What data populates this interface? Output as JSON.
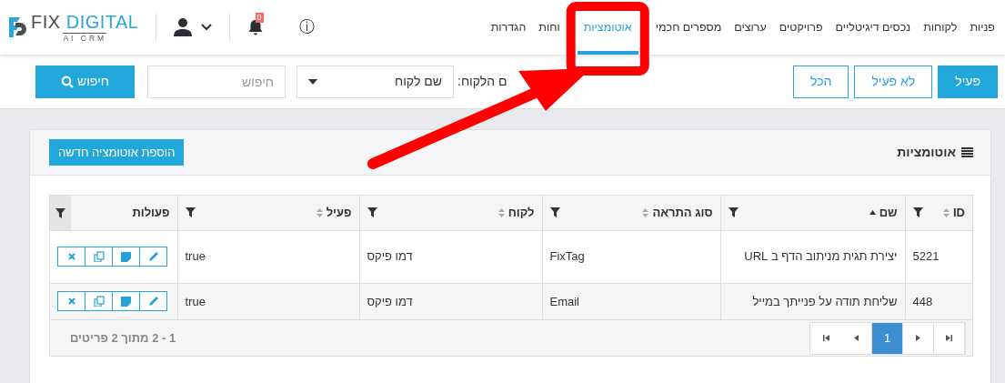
{
  "logo": {
    "word1": "FIX",
    "word2": "DIGITAL",
    "tagline": "AI CRM"
  },
  "notifications": {
    "count": "0"
  },
  "info": {
    "glyph": "ⓘ"
  },
  "nav": [
    {
      "label": "פניות",
      "selected": false
    },
    {
      "label": "לקוחות",
      "selected": false
    },
    {
      "label": "נכסים דיגיטליים",
      "selected": false
    },
    {
      "label": "פרויקטים",
      "selected": false
    },
    {
      "label": "ערוצים",
      "selected": false
    },
    {
      "label": "מספרים חכמי",
      "selected": false
    },
    {
      "label": "אוטומציות",
      "selected": true
    },
    {
      "label": "וחות",
      "selected": false
    },
    {
      "label": "הגדרות",
      "selected": false
    }
  ],
  "status_filter": [
    {
      "label": "פעיל",
      "selected": true
    },
    {
      "label": "לא פעיל",
      "selected": false
    },
    {
      "label": "הכל",
      "selected": false
    }
  ],
  "customer_filter": {
    "label": "ם הלקוח:",
    "value": "שם לקוח"
  },
  "search": {
    "placeholder": "חיפוש",
    "button": "חיפוש"
  },
  "card": {
    "title": "אוטומציות",
    "add_button": "הוספת אוטומציה חדשה"
  },
  "table": {
    "columns": [
      {
        "label": "ID",
        "sortable": true,
        "sorted": false
      },
      {
        "label": "שם",
        "sortable": true,
        "sorted": true
      },
      {
        "label": "סוג התראה",
        "sortable": true,
        "sorted": false
      },
      {
        "label": "לקוח",
        "sortable": true,
        "sorted": false
      },
      {
        "label": "פעיל",
        "sortable": true,
        "sorted": false
      },
      {
        "label": "פעולות",
        "sortable": false
      }
    ],
    "rows": [
      [
        "5221",
        "יצירת תגית מניתוב הדף ב URL",
        "FixTag",
        "דמו פיקס",
        "true"
      ],
      [
        "448",
        "שליחת תודה על פנייתך במייל",
        "Email",
        "דמו פיקס",
        "true"
      ]
    ]
  },
  "pager": {
    "pages": [
      {
        "label": "1",
        "selected": true
      }
    ],
    "summary": "1 - 2 מתוך 2 פריטים"
  },
  "annotations": {
    "highlight_box": true,
    "arrow": true
  }
}
